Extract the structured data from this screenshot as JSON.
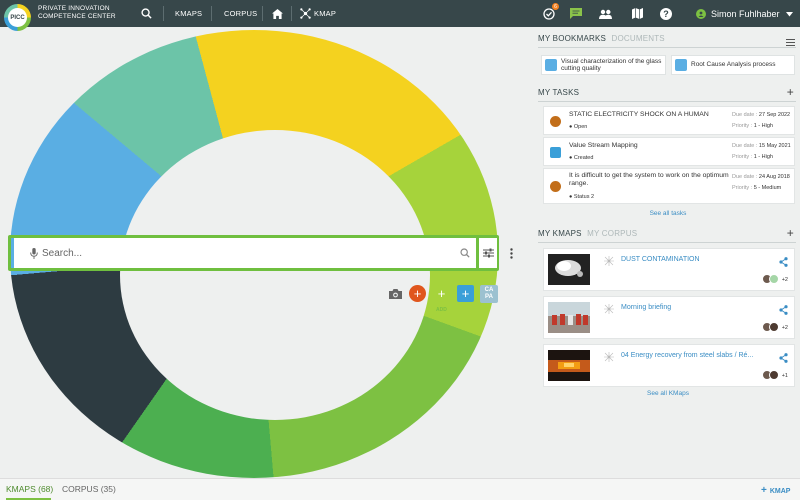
{
  "topbar": {
    "logo_text": "PICC",
    "org_line1": "PRIVATE INNOVATION",
    "org_line2": "COMPETENCE CENTER",
    "nav": {
      "kmaps": "KMAPS",
      "corpus": "CORPUS",
      "kmap": "KMAP"
    },
    "notification_count": "6",
    "user_name": "Simon Fuhlhaber"
  },
  "search": {
    "placeholder": "Search..."
  },
  "actions": {
    "add_label": "ADD",
    "capa_line1": "CA",
    "capa_line2": "PA"
  },
  "bookmarks": {
    "tab_active": "MY BOOKMARKS",
    "tab_inactive": "DOCUMENTS",
    "items": [
      {
        "label": "Visual characterization of the glass cutting quality"
      },
      {
        "label": "Root Cause Analysis process"
      }
    ]
  },
  "tasks": {
    "title": "MY TASKS",
    "due_label": "Due date :",
    "priority_label": "Priority :",
    "items": [
      {
        "title": "STATIC ELECTRICITY SHOCK ON A HUMAN",
        "status": "Open",
        "due": "27 Sep 2022",
        "priority": "1 - High"
      },
      {
        "title": "Value Stream Mapping",
        "status": "Created",
        "due": "15 May 2021",
        "priority": "1 - High"
      },
      {
        "title": "It is difficult to get the system to work on the optimum range.",
        "status": "Status 2",
        "due": "24 Aug 2018",
        "priority": "5 - Medium"
      }
    ],
    "see_all": "See all tasks"
  },
  "kmaps": {
    "tab_active": "MY KMAPS",
    "tab_inactive": "MY CORPUS",
    "items": [
      {
        "title": "DUST CONTAMINATION",
        "members_extra": "+2"
      },
      {
        "title": "Morning briefing",
        "members_extra": "+2"
      },
      {
        "title": "04 Energy recovery from steel slabs / Ré...",
        "members_extra": "+1"
      }
    ],
    "see_all": "See all KMaps"
  },
  "bottom": {
    "tab_kmaps": "KMAPS (68)",
    "tab_corpus": "CORPUS (35)",
    "add_kmap": "KMAP"
  }
}
